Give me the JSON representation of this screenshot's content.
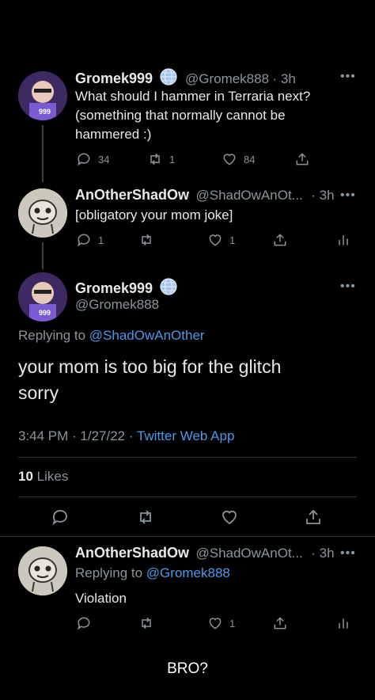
{
  "tweet1": {
    "name": "Gromek999",
    "handle": "@Gromek888",
    "time": "· 3h",
    "text_line1": "What should I hammer in Terraria next?",
    "text_line2": "(something that normally cannot be",
    "text_line3": "hammered :)",
    "replies": "34",
    "retweets": "1",
    "likes": "84"
  },
  "tweet2": {
    "name": "AnOtherShadOw",
    "handle": "@ShadOwAnOt...",
    "time": "· 3h",
    "text": "[obligatory your mom joke]",
    "replies": "1",
    "likes": "1"
  },
  "main": {
    "name": "Gromek999",
    "handle": "@Gromek888",
    "replying_prefix": "Replying to",
    "replying_to": "@ShadOwAnOther",
    "text_line1": "your mom is too big for the glitch",
    "text_line2": "sorry",
    "time_date": "3:44 PM · 1/27/22 ·",
    "source": "Twitter Web App",
    "likes_count": "10",
    "likes_label": "Likes"
  },
  "reply": {
    "name": "AnOtherShadOw",
    "handle": "@ShadOwAnOt...",
    "time": "· 3h",
    "replying_prefix": "Replying to",
    "replying_to": "@Gromek888",
    "text": "Violation",
    "likes": "1"
  },
  "caption": "BRO?",
  "colors": {
    "background": "#000000",
    "text": "#e7e9ea",
    "muted": "#8b949b",
    "link": "#4a99e9"
  }
}
